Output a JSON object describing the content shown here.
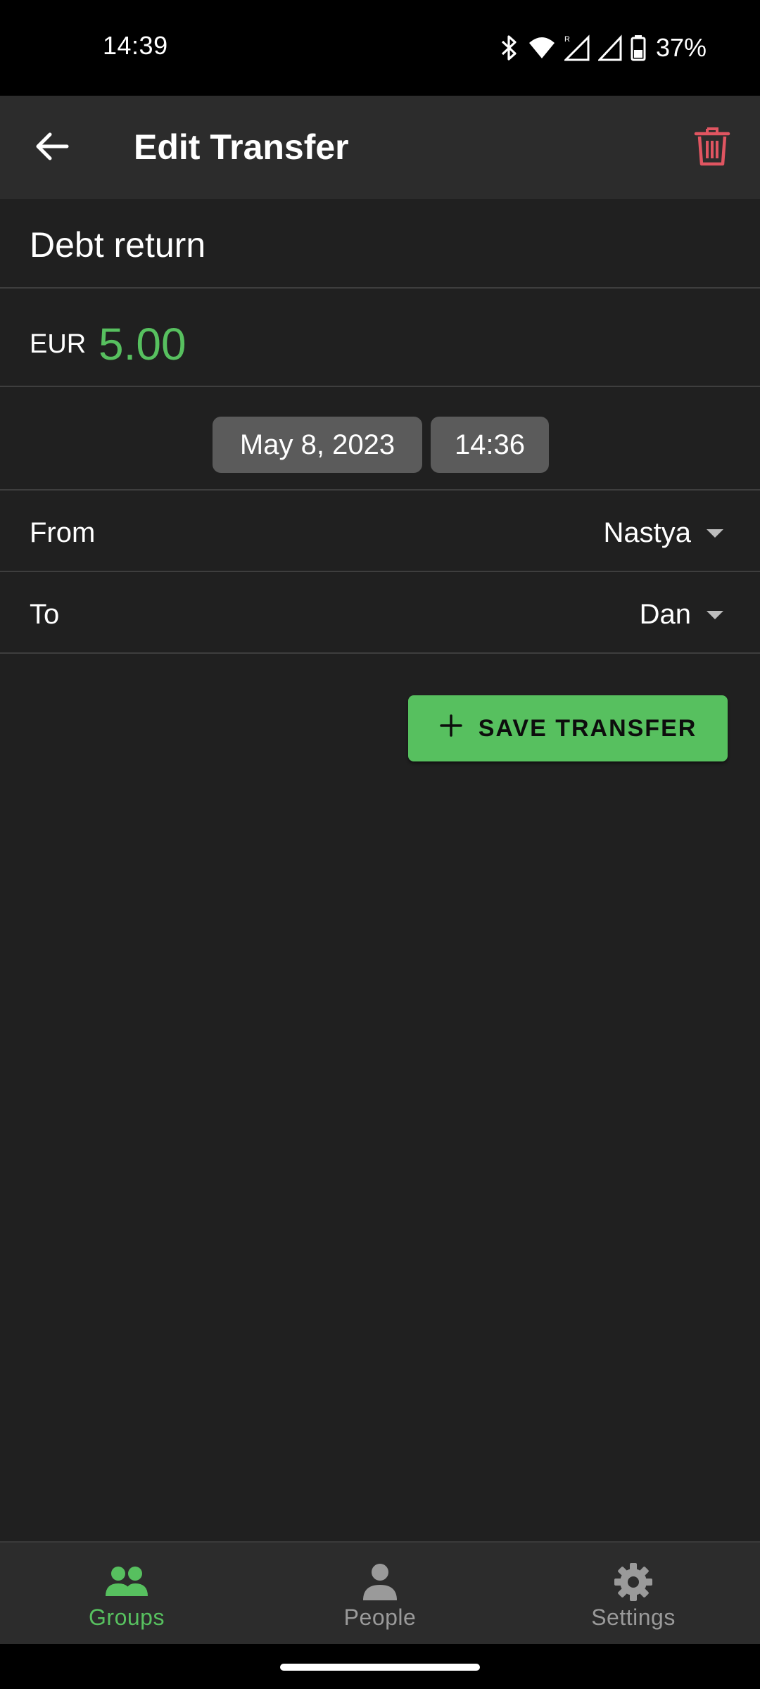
{
  "status_bar": {
    "time": "14:39",
    "battery": "37%",
    "icons": [
      "bluetooth-icon",
      "wifi-icon",
      "signal-roaming-icon",
      "signal-icon",
      "battery-icon"
    ]
  },
  "app_bar": {
    "title": "Edit Transfer",
    "back_icon": "arrow-left-icon",
    "delete_icon": "trash-icon"
  },
  "form": {
    "title_value": "Debt return",
    "currency": "EUR",
    "amount": "5.00",
    "date": "May 8, 2023",
    "time": "14:36",
    "from_label": "From",
    "from_value": "Nastya",
    "to_label": "To",
    "to_value": "Dan",
    "save_label": "SAVE TRANSFER"
  },
  "bottom_nav": {
    "items": [
      {
        "label": "Groups",
        "icon": "groups-icon",
        "active": true
      },
      {
        "label": "People",
        "icon": "person-icon",
        "active": false
      },
      {
        "label": "Settings",
        "icon": "gear-icon",
        "active": false
      }
    ]
  },
  "colors": {
    "accent": "#57c05f",
    "danger": "#e05561",
    "background": "#202020",
    "app_bar": "#2c2c2c"
  }
}
